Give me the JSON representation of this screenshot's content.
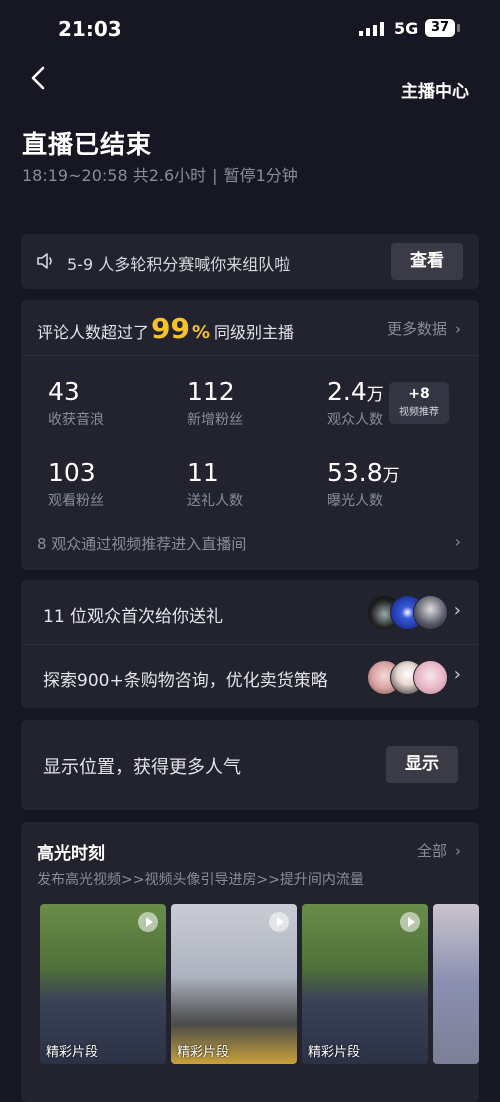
{
  "status_bar": {
    "time": "21:03",
    "network": "5G",
    "battery": "37"
  },
  "header": {
    "center_link": "主播中心"
  },
  "summary": {
    "title": "直播已结束",
    "time_range": "18:19~20:58 共2.6小时",
    "pause": "暂停1分钟"
  },
  "notice": {
    "text": "5-9 人多轮积分赛喊你来组队啦",
    "button": "查看"
  },
  "stats": {
    "headline_prefix": "评论人数超过了",
    "headline_percent": "99",
    "headline_percent_sign": "%",
    "headline_suffix": "同级别主播",
    "more_label": "更多数据",
    "items": [
      {
        "value": "43",
        "unit": "",
        "label": "收获音浪"
      },
      {
        "value": "112",
        "unit": "",
        "label": "新增粉丝"
      },
      {
        "value": "2.4",
        "unit": "万",
        "label": "观众人数"
      },
      {
        "value": "103",
        "unit": "",
        "label": "观看粉丝"
      },
      {
        "value": "11",
        "unit": "",
        "label": "送礼人数"
      },
      {
        "value": "53.8",
        "unit": "万",
        "label": "曝光人数"
      }
    ],
    "badge": {
      "value": "+8",
      "label": "视频推荐"
    },
    "footer": "8 观众通过视频推荐进入直播间"
  },
  "gifts": {
    "row1": "11 位观众首次给你送礼",
    "row2": "探索900+条购物咨询，优化卖货策略"
  },
  "location": {
    "text": "显示位置，获得更多人气",
    "button": "显示"
  },
  "highlights": {
    "title": "高光时刻",
    "more_label": "全部",
    "subtitle": "发布高光视频>>视频头像引导进房>>提升间内流量",
    "clip_label": "精彩片段"
  }
}
